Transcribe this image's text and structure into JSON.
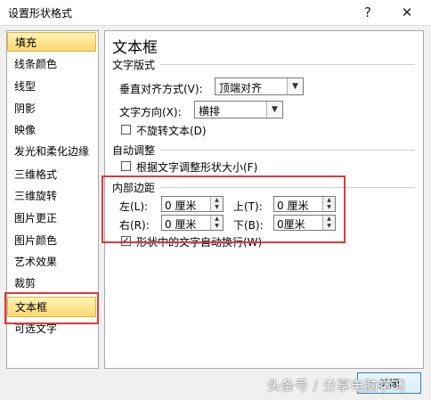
{
  "window": {
    "title": "设置形状格式",
    "help_icon": "?",
    "close_icon": "✕"
  },
  "sidebar": {
    "items": [
      {
        "label": "填充",
        "active": true
      },
      {
        "label": "线条颜色"
      },
      {
        "label": "线型"
      },
      {
        "label": "阴影"
      },
      {
        "label": "映像"
      },
      {
        "label": "发光和柔化边缘"
      },
      {
        "label": "三维格式"
      },
      {
        "label": "三维旋转"
      },
      {
        "label": "图片更正"
      },
      {
        "label": "图片颜色"
      },
      {
        "label": "艺术效果"
      },
      {
        "label": "裁剪"
      },
      {
        "label": "文本框",
        "active": true
      },
      {
        "label": "可选文字"
      }
    ]
  },
  "panel": {
    "heading": "文本框",
    "layout_section": "文字版式",
    "vertical_align_label": "垂直对齐方式(V):",
    "vertical_align_value": "顶端对齐",
    "direction_label": "文字方向(X):",
    "direction_value": "横排",
    "no_rotate_label": "不旋转文本(D)",
    "autofit_section": "自动调整",
    "resize_label": "根据文字调整形状大小(F)",
    "margin_section": "内部边距",
    "left_label": "左(L):",
    "left_value": "0 厘米",
    "top_label": "上(T):",
    "top_value": "0 厘米",
    "right_label": "右(R):",
    "right_value": "0 厘米",
    "bottom_label": "下(B):",
    "bottom_value": "0厘米",
    "wrap_label": "形状中的文字自动换行(W)",
    "wrap_check": "✓"
  },
  "footer": {
    "watermark": "头条号 / 分享电脑学习",
    "close_button": "关闭"
  },
  "colors": {
    "highlight_box": "#e0383e",
    "active_item": "#fbd870"
  }
}
